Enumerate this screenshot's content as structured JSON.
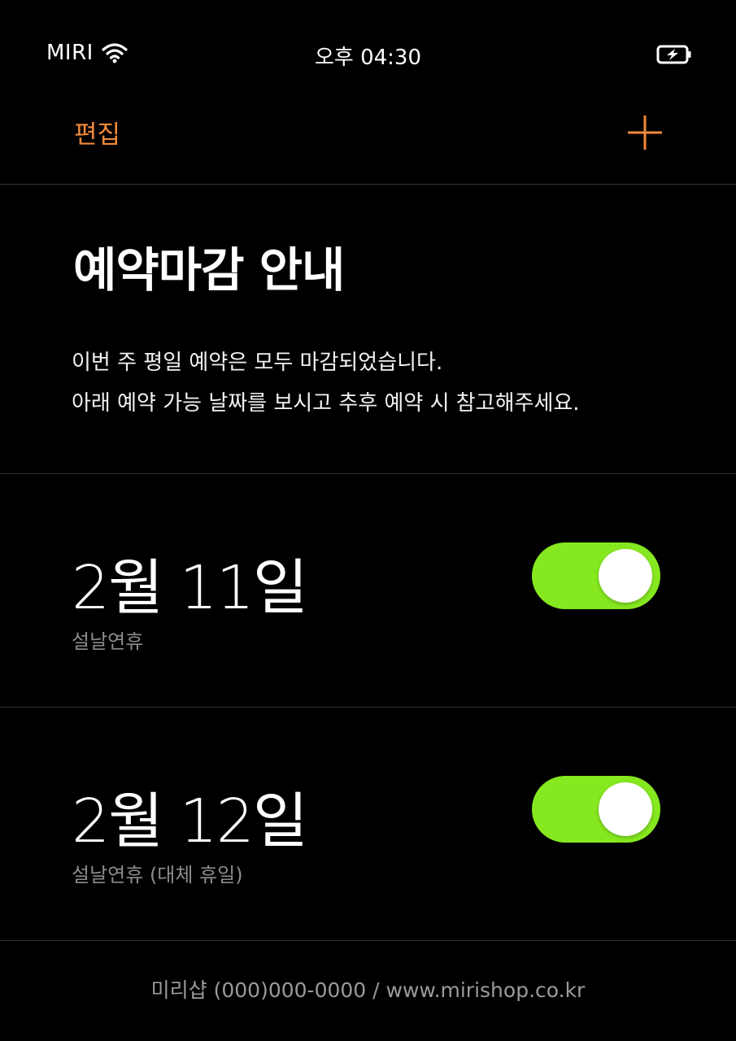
{
  "status_bar": {
    "carrier": "MIRI",
    "time": "오후 04:30"
  },
  "nav": {
    "edit_label": "편집",
    "add_icon": "plus-icon"
  },
  "notice": {
    "title": "예약마감 안내",
    "lines": [
      "이번 주 평일 예약은 모두 마감되었습니다.",
      "아래 예약 가능 날짜를 보시고 추후 예약 시 참고해주세요."
    ]
  },
  "dates": [
    {
      "date": "2월 11일",
      "note": "설날연휴",
      "enabled": true
    },
    {
      "date": "2월 12일",
      "note": "설날연휴 (대체 휴일)",
      "enabled": true
    }
  ],
  "footer": {
    "text": "미리샵 (000)000-0000 / www.mirishop.co.kr"
  },
  "colors": {
    "accent": "#f0893a",
    "toggle_on": "#86e81f",
    "background": "#000000"
  }
}
